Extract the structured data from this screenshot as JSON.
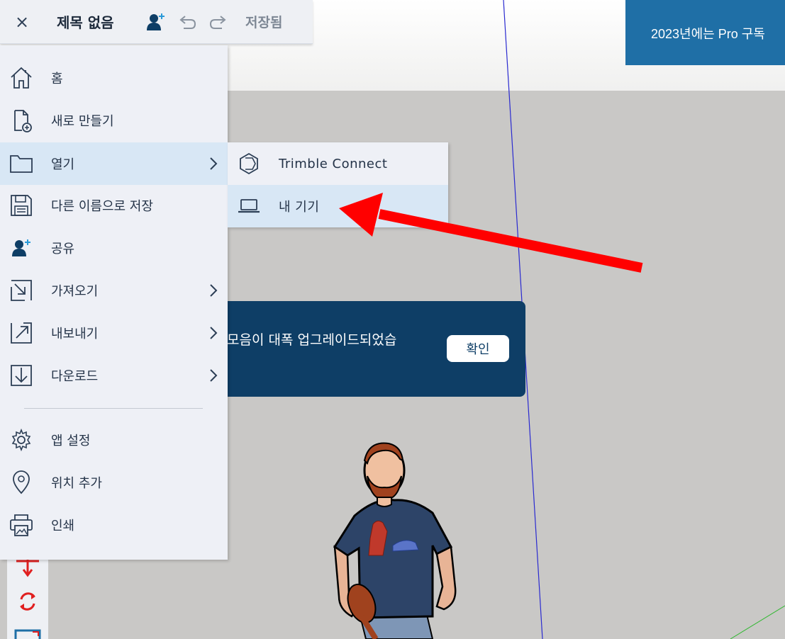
{
  "header": {
    "close_label": "×",
    "title": "제목 없음",
    "saved_label": "저장됨"
  },
  "promo": {
    "text": "2023년에는 Pro 구독"
  },
  "menu": {
    "items": [
      {
        "label": "홈",
        "icon": "home-icon"
      },
      {
        "label": "새로 만들기",
        "icon": "new-file-icon"
      },
      {
        "label": "열기",
        "icon": "folder-icon"
      },
      {
        "label": "다른 이름으로 저장",
        "icon": "save-icon"
      },
      {
        "label": "공유",
        "icon": "share-user-icon"
      },
      {
        "label": "가져오기",
        "icon": "import-icon"
      },
      {
        "label": "내보내기",
        "icon": "export-icon"
      },
      {
        "label": "다운로드",
        "icon": "download-icon"
      },
      {
        "label": "앱 설정",
        "icon": "gear-icon"
      },
      {
        "label": "위치 추가",
        "icon": "location-pin-icon"
      },
      {
        "label": "인쇄",
        "icon": "print-icon"
      }
    ]
  },
  "submenu": {
    "items": [
      {
        "label": "Trimble Connect",
        "icon": "trimble-connect-icon"
      },
      {
        "label": "내 기기",
        "icon": "laptop-icon"
      }
    ]
  },
  "toast": {
    "message": "모음이 대폭 업그레이드되었습",
    "ok_label": "확인"
  },
  "colors": {
    "accent": "#1f6fa6",
    "toast_bg": "#0e3e66",
    "menu_bg": "#eef0f6",
    "active_bg": "#d8e7f5",
    "annotation_arrow": "#ff0000"
  }
}
